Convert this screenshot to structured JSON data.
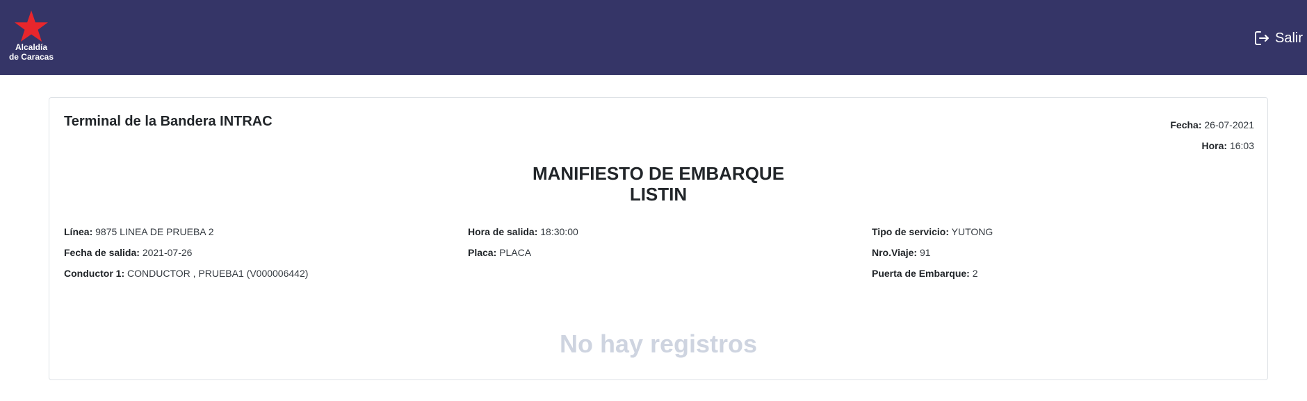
{
  "header": {
    "logo_line1": "Alcaldía",
    "logo_line2": "de Caracas",
    "logout_label": "Salir",
    "logout_icon": "logout-icon",
    "colors": {
      "bar": "#353567",
      "star": "#e8262c"
    }
  },
  "card": {
    "terminal": "Terminal de la Bandera INTRAC",
    "fecha_label": "Fecha:",
    "fecha_value": "26-07-2021",
    "hora_label": "Hora:",
    "hora_value": "16:03",
    "title_line1": "MANIFIESTO DE EMBARQUE",
    "title_line2": "LISTIN",
    "info": {
      "linea_label": "Línea:",
      "linea_value": "9875 LINEA DE PRUEBA 2",
      "fecha_salida_label": "Fecha de salida:",
      "fecha_salida_value": "2021-07-26",
      "conductor_label": "Conductor 1:",
      "conductor_value": "CONDUCTOR , PRUEBA1 (V000006442)",
      "hora_salida_label": "Hora de salida:",
      "hora_salida_value": "18:30:00",
      "placa_label": "Placa:",
      "placa_value": "PLACA",
      "tipo_servicio_label": "Tipo de servicio:",
      "tipo_servicio_value": "YUTONG",
      "nro_viaje_label": "Nro.Viaje:",
      "nro_viaje_value": "91",
      "puerta_label": "Puerta de Embarque:",
      "puerta_value": "2"
    },
    "empty_message": "No hay registros"
  }
}
